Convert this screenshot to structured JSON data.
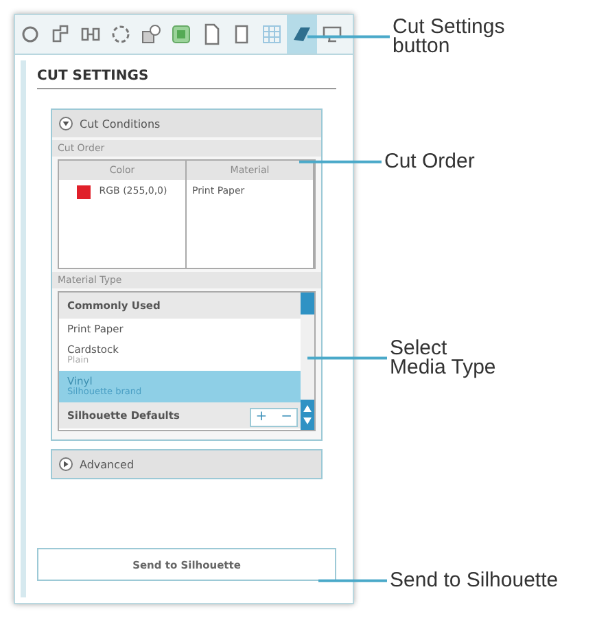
{
  "toolbar": [
    {
      "selected": false
    },
    {
      "selected": false
    },
    {
      "selected": false
    },
    {
      "selected": false
    },
    {
      "selected": false
    },
    {
      "selected": false
    },
    {
      "selected": false
    },
    {
      "selected": false
    },
    {
      "selected": false
    },
    {
      "selected": true
    },
    {
      "selected": false
    }
  ],
  "panel": {
    "title": "CUT SETTINGS",
    "cut_conditions": {
      "label": "Cut Conditions",
      "expanded": true,
      "cut_order": {
        "label": "Cut Order",
        "columns": [
          "Color",
          "Material"
        ],
        "rows": [
          {
            "color": "#e0202a",
            "color_label": "RGB (255,0,0)",
            "material": "Print Paper"
          }
        ]
      },
      "material_type": {
        "label": "Material Type",
        "items": [
          {
            "kind": "group",
            "label": "Commonly Used",
            "selected": false
          },
          {
            "kind": "item",
            "label": "Print Paper",
            "selected": false
          },
          {
            "kind": "item",
            "label": "Cardstock",
            "sublabel": "Plain",
            "selected": false
          },
          {
            "kind": "item",
            "label": "Vinyl",
            "sublabel": "Silhouette brand",
            "selected": true
          },
          {
            "kind": "group",
            "label": "Silhouette Defaults",
            "selected": false
          }
        ],
        "add_button": "+",
        "remove_button": "−"
      }
    },
    "advanced": {
      "label": "Advanced",
      "expanded": false
    },
    "send_button": "Send to Silhouette"
  },
  "callouts": [
    "Cut Settings\nbutton",
    "Cut Order",
    "Select\nMedia Type",
    "Send to Silhouette"
  ]
}
